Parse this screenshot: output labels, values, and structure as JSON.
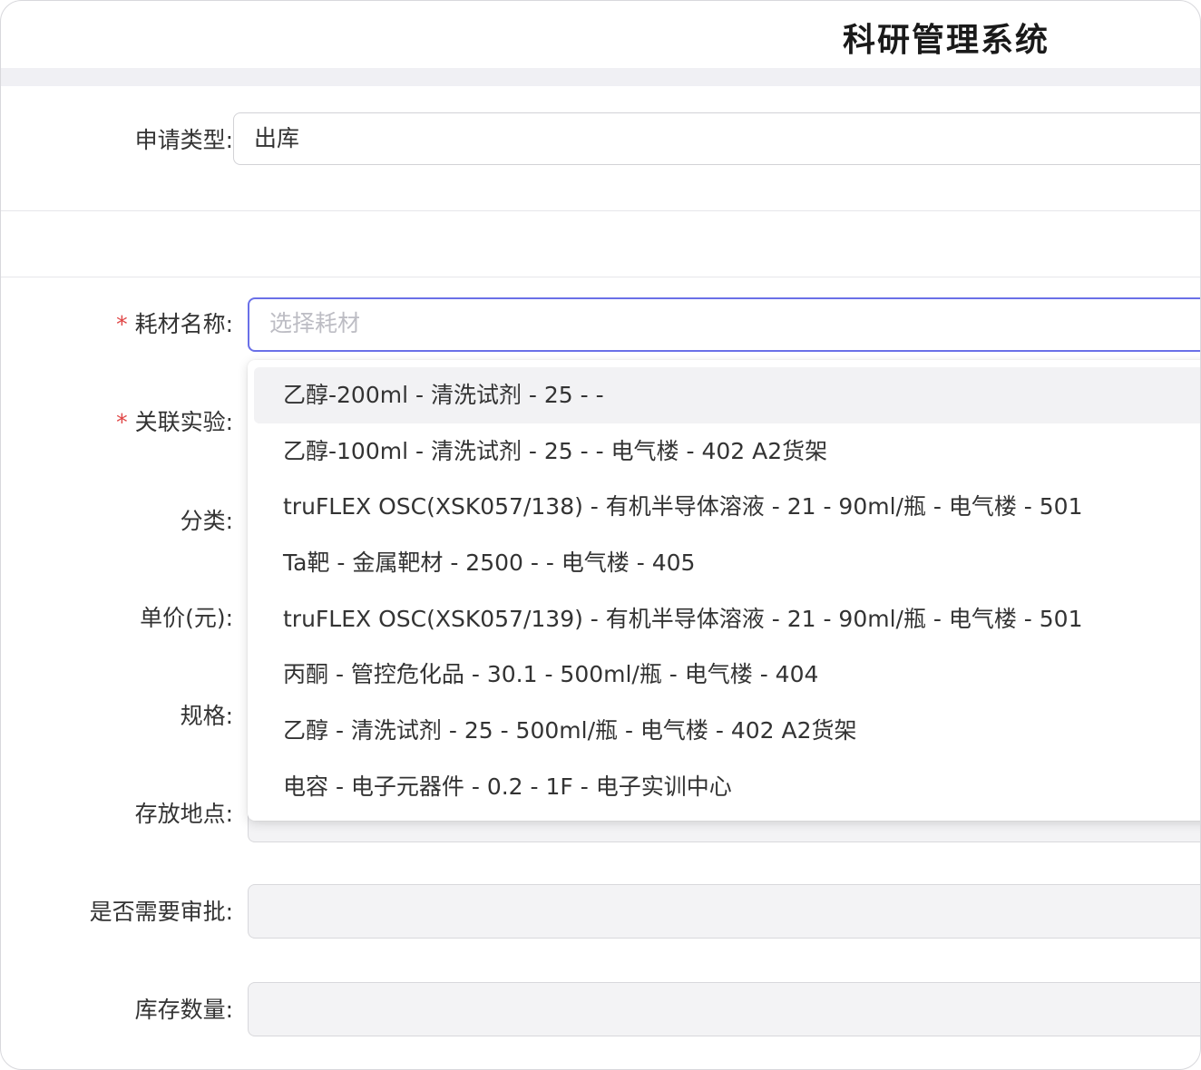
{
  "app": {
    "title": "科研管理系统"
  },
  "form": {
    "apply_type": {
      "label": "申请类型:",
      "value": "出库"
    },
    "material_name": {
      "label": "耗材名称:",
      "required": "*",
      "placeholder": "选择耗材"
    },
    "related_experiment": {
      "label": "关联实验:",
      "required": "*"
    },
    "category": {
      "label": "分类:"
    },
    "unit_price": {
      "label": "单价(元):"
    },
    "spec": {
      "label": "规格:"
    },
    "location": {
      "label": "存放地点:"
    },
    "need_approval": {
      "label": "是否需要审批:"
    },
    "stock_quantity": {
      "label": "库存数量:"
    }
  },
  "dropdown": {
    "options": [
      "乙醇-200ml - 清洗试剂 - 25 - -",
      "乙醇-100ml - 清洗试剂 - 25 - - 电气楼 - 402 A2货架",
      "truFLEX OSC(XSK057/138) - 有机半导体溶液 - 21 - 90ml/瓶 - 电气楼 - 501",
      "Ta靶 - 金属靶材 - 2500 - - 电气楼 - 405",
      "truFLEX OSC(XSK057/139) - 有机半导体溶液 - 21 - 90ml/瓶 - 电气楼 - 501",
      "丙酮 - 管控危化品 - 30.1 - 500ml/瓶 - 电气楼 - 404",
      "乙醇 - 清洗试剂 - 25 - 500ml/瓶 - 电气楼 - 402 A2货架",
      "电容 - 电子元器件 - 0.2 - 1F - 电子实训中心"
    ],
    "highlighted_option": "乙醇-200ml - 清洗试剂 - 25 - -"
  },
  "colors": {
    "accent": "#6a70e8",
    "required": "#e04545",
    "disabled_bg": "#f3f3f5"
  }
}
